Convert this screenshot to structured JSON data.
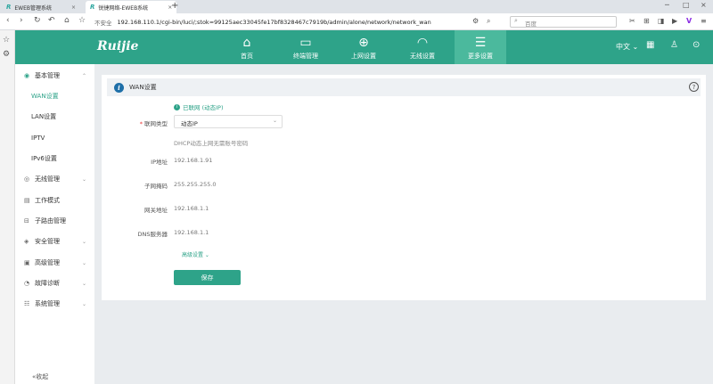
{
  "browser": {
    "tabs": [
      {
        "logo": "R",
        "title": "EWEB管理系统",
        "close": "×"
      },
      {
        "logo": "R",
        "title": "锐捷网络-EWEB系统",
        "close": "×"
      }
    ],
    "new_tab": "+",
    "window_controls": [
      "─",
      "□",
      "×"
    ],
    "nav": {
      "back": "‹",
      "forward": "›",
      "reload": "↻",
      "history": "↶",
      "home": "⌂",
      "bookmark": "☆"
    },
    "insecure_label": "不安全",
    "url": "192.168.110.1/cgi-bin/luci/;stok=99125aec33045fe17bf8328467c7919b/admin/alone/network/network_wan",
    "search_placeholder": "百度",
    "toolbar_icons": [
      "⚙",
      "⌕",
      "✂",
      "⊞",
      "◨",
      "▶",
      "V",
      "≡"
    ]
  },
  "left_strip_icons": [
    "☆",
    "⚙"
  ],
  "app": {
    "brand": "Ruijie",
    "nav": [
      {
        "icon": "⌂",
        "label": "首页"
      },
      {
        "icon": "▭",
        "label": "终端管理"
      },
      {
        "icon": "⊕",
        "label": "上网设置"
      },
      {
        "icon": "◠",
        "label": "无线设置"
      },
      {
        "icon": "☰",
        "label": "更多设置"
      }
    ],
    "lang": "中文 ⌄",
    "right_icons": [
      "▦",
      "♙",
      "⊙"
    ]
  },
  "sidebar": {
    "items": [
      {
        "icon": "◉",
        "label": "基本管理",
        "chev": "⌃"
      },
      {
        "label": "WAN设置"
      },
      {
        "label": "LAN设置"
      },
      {
        "label": "IPTV"
      },
      {
        "label": "IPv6设置"
      },
      {
        "icon": "◎",
        "label": "无线管理",
        "chev": "⌄"
      },
      {
        "icon": "▤",
        "label": "工作模式"
      },
      {
        "icon": "⊟",
        "label": "子路由管理"
      },
      {
        "icon": "◈",
        "label": "安全管理",
        "chev": "⌄"
      },
      {
        "icon": "▣",
        "label": "高级管理",
        "chev": "⌄"
      },
      {
        "icon": "◔",
        "label": "故障诊断",
        "chev": "⌄"
      },
      {
        "icon": "☷",
        "label": "系统管理",
        "chev": "⌄"
      }
    ],
    "collapse": "«收起"
  },
  "panel": {
    "info_icon": "i",
    "title": "WAN设置",
    "help": "?",
    "status_icon": "i",
    "status": "已联网 (动态IP)",
    "conn_type_label": "联网类型",
    "required_mark": "*",
    "conn_type_value": "动态IP",
    "select_caret": "⌄",
    "hint": "DHCP动态上网无需账号密码",
    "fields": [
      {
        "label": "IP地址",
        "value": "192.168.1.91"
      },
      {
        "label": "子网掩码",
        "value": "255.255.255.0"
      },
      {
        "label": "网关地址",
        "value": "192.168.1.1"
      },
      {
        "label": "DNS服务器",
        "value": "192.168.1.1"
      }
    ],
    "advanced": "高级设置 ⌄",
    "save": "保存"
  },
  "colors": {
    "accent": "#2ea389",
    "active_nav": "#4bb99d",
    "info": "#1e6fa8"
  }
}
